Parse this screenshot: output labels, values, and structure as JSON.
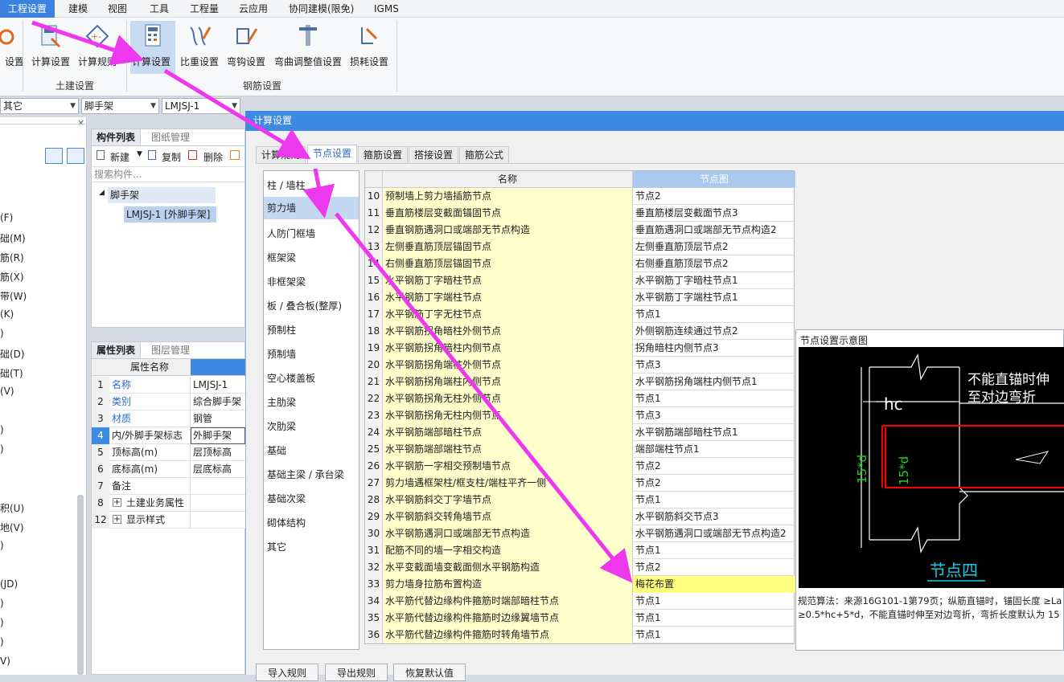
{
  "menubar": [
    "工程设置",
    "建模",
    "视图",
    "工具",
    "工程量",
    "云应用",
    "协同建模(限免)",
    "IGMS"
  ],
  "ribbon": {
    "partial_left": "设置",
    "civil_buttons": [
      "计算设置",
      "计算规则"
    ],
    "rebar_buttons": [
      "计算设置",
      "比重设置",
      "弯钩设置",
      "弯曲调整值设置",
      "损耗设置"
    ],
    "groups": [
      "土建设置",
      "钢筋设置"
    ]
  },
  "combos": [
    "其它",
    "脚手架",
    "LMJSJ-1"
  ],
  "left_items": [
    "(F)",
    "础(M)",
    "筋(R)",
    "筋(X)",
    "带(W)",
    "(K)",
    ")",
    "础(D)",
    "础(T)",
    "(V)",
    ")",
    ")",
    "积(U)",
    "地(V)",
    ")",
    "(JD)",
    ")",
    ")",
    ")",
    "V)"
  ],
  "component_panel": {
    "tabs": [
      "构件列表",
      "图纸管理"
    ],
    "toolbar": [
      "新建",
      "复制",
      "删除"
    ],
    "search_placeholder": "搜索构件...",
    "tree_root": "脚手架",
    "tree_child": "LMJSJ-1 [外脚手架]"
  },
  "attr_panel": {
    "tabs": [
      "属性列表",
      "图层管理"
    ],
    "header_name": "属性名称",
    "rows": [
      {
        "no": "1",
        "name": "名称",
        "value": "LMJSJ-1"
      },
      {
        "no": "2",
        "name": "类别",
        "value": "综合脚手架"
      },
      {
        "no": "3",
        "name": "材质",
        "value": "钢管"
      },
      {
        "no": "4",
        "name": "内/外脚手架标志",
        "value": "外脚手架"
      },
      {
        "no": "5",
        "name": "顶标高(m)",
        "value": "层顶标高"
      },
      {
        "no": "6",
        "name": "底标高(m)",
        "value": "层底标高"
      },
      {
        "no": "7",
        "name": "备注",
        "value": ""
      },
      {
        "no": "8",
        "name": "土建业务属性",
        "value": ""
      },
      {
        "no": "12",
        "name": "显示样式",
        "value": ""
      }
    ]
  },
  "dialog": {
    "title": "计算设置",
    "tabs": [
      "计算规则",
      "节点设置",
      "箍筋设置",
      "搭接设置",
      "箍筋公式"
    ],
    "categories": [
      "柱 / 墙柱",
      "剪力墙",
      "人防门框墙",
      "框架梁",
      "非框架梁",
      "板 / 叠合板(整厚)",
      "预制柱",
      "预制墙",
      "空心楼盖板",
      "主肋梁",
      "次肋梁",
      "基础",
      "基础主梁 / 承台梁",
      "基础次梁",
      "砌体结构",
      "其它"
    ],
    "grid_headers": [
      "名称",
      "节点图"
    ],
    "rows": [
      {
        "no": "10",
        "name": "预制墙上剪力墙插筋节点",
        "node": "节点2"
      },
      {
        "no": "11",
        "name": "垂直筋楼层变截面锚固节点",
        "node": "垂直筋楼层变截面节点3"
      },
      {
        "no": "12",
        "name": "垂直钢筋遇洞口或端部无节点构造",
        "node": "垂直筋遇洞口或端部无节点构造2"
      },
      {
        "no": "13",
        "name": "左侧垂直筋顶层锚固节点",
        "node": "左侧垂直筋顶层节点2"
      },
      {
        "no": "14",
        "name": "右侧垂直筋顶层锚固节点",
        "node": "右侧垂直筋顶层节点2"
      },
      {
        "no": "15",
        "name": "水平钢筋丁字暗柱节点",
        "node": "水平钢筋丁字暗柱节点1"
      },
      {
        "no": "16",
        "name": "水平钢筋丁字端柱节点",
        "node": "水平钢筋丁字端柱节点1"
      },
      {
        "no": "17",
        "name": "水平钢筋丁字无柱节点",
        "node": "节点1"
      },
      {
        "no": "18",
        "name": "水平钢筋拐角暗柱外侧节点",
        "node": "外侧钢筋连续通过节点2"
      },
      {
        "no": "19",
        "name": "水平钢筋拐角暗柱内侧节点",
        "node": "拐角暗柱内侧节点3"
      },
      {
        "no": "20",
        "name": "水平钢筋拐角端柱外侧节点",
        "node": "节点3"
      },
      {
        "no": "21",
        "name": "水平钢筋拐角端柱内侧节点",
        "node": "水平钢筋拐角端柱内侧节点1"
      },
      {
        "no": "22",
        "name": "水平钢筋拐角无柱外侧节点",
        "node": "节点1"
      },
      {
        "no": "23",
        "name": "水平钢筋拐角无柱内侧节点",
        "node": "节点3"
      },
      {
        "no": "24",
        "name": "水平钢筋端部暗柱节点",
        "node": "水平钢筋端部暗柱节点1"
      },
      {
        "no": "25",
        "name": "水平钢筋端部端柱节点",
        "node": "端部端柱节点1"
      },
      {
        "no": "26",
        "name": "水平钢筋一字相交预制墙节点",
        "node": "节点2"
      },
      {
        "no": "27",
        "name": "剪力墙遇框架柱/框支柱/端柱平齐一侧",
        "node": "节点2"
      },
      {
        "no": "28",
        "name": "水平钢筋斜交丁字墙节点",
        "node": "节点1"
      },
      {
        "no": "29",
        "name": "水平钢筋斜交转角墙节点",
        "node": "水平钢筋斜交节点3"
      },
      {
        "no": "30",
        "name": "水平钢筋遇洞口或端部无节点构造",
        "node": "水平钢筋遇洞口或端部无节点构造2"
      },
      {
        "no": "31",
        "name": "配筋不同的墙一字相交构造",
        "node": "节点1"
      },
      {
        "no": "32",
        "name": "水平变截面墙变截面侧水平钢筋构造",
        "node": "节点2"
      },
      {
        "no": "33",
        "name": "剪力墙身拉筋布置构造",
        "node": "梅花布置"
      },
      {
        "no": "34",
        "name": "水平筋代替边缘构件箍筋时端部暗柱节点",
        "node": "节点1"
      },
      {
        "no": "35",
        "name": "水平筋代替边缘构件箍筋时边缘翼墙节点",
        "node": "节点1"
      },
      {
        "no": "36",
        "name": "水平筋代替边缘构件箍筋时转角墙节点",
        "node": "节点1"
      }
    ],
    "preview": {
      "title": "节点设置示意图",
      "diagram_text1": "不能直锚时伸",
      "diagram_text2": "至对边弯折",
      "label_hc": "hc",
      "label_15d": "15*d",
      "node_name": "节点四",
      "desc1": "规范算法：来源16G101-1第79页；纵筋直锚时，锚固长度 ≥La",
      "desc2": "≥0.5*hc+5*d，不能直锚时伸至对边弯折，弯折长度默认为 15"
    },
    "buttons": [
      "导入规则",
      "导出规则",
      "恢复默认值"
    ]
  },
  "colors": {
    "accent": "#3c8ae2",
    "arrow": "#ee38ee",
    "highlight": "#ffff80"
  }
}
